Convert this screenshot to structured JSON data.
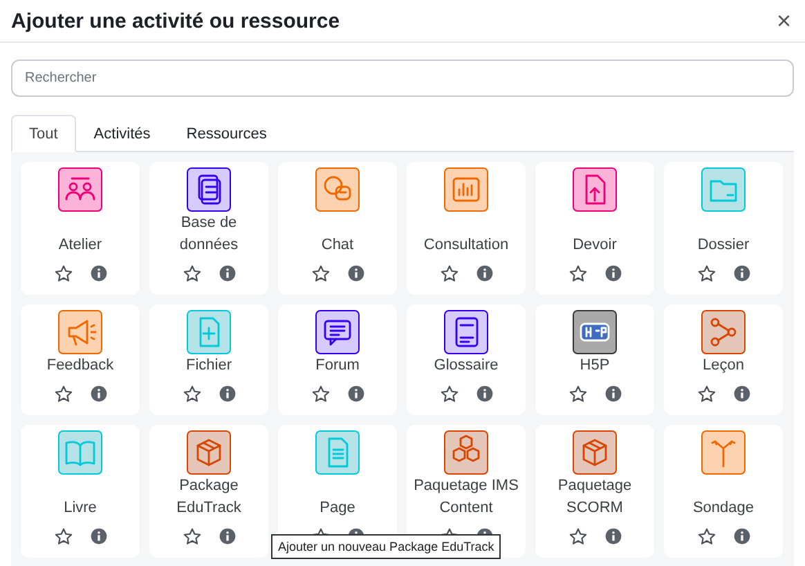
{
  "dialog": {
    "title": "Ajouter une activité ou ressource",
    "close": "×"
  },
  "search": {
    "placeholder": "Rechercher"
  },
  "tabs": [
    {
      "label": "Tout",
      "selected": true
    },
    {
      "label": "Activités",
      "selected": false
    },
    {
      "label": "Ressources",
      "selected": false
    }
  ],
  "items": [
    {
      "label": "Atelier",
      "kind": "people",
      "color": "#fbb4d8",
      "starred": false
    },
    {
      "label": "Base de données",
      "kind": "database",
      "color": "#d6cbfd",
      "starred": false
    },
    {
      "label": "Chat",
      "kind": "chat",
      "color": "#fcd2b1",
      "starred": false
    },
    {
      "label": "Consultation",
      "kind": "chart",
      "color": "#fcd2b1",
      "starred": false
    },
    {
      "label": "Devoir",
      "kind": "upload",
      "color": "#fbb4d8",
      "starred": false
    },
    {
      "label": "Dossier",
      "kind": "folder",
      "color": "#b5e2e6",
      "starred": false
    },
    {
      "label": "Feedback",
      "kind": "megaphone",
      "color": "#fcd2b1",
      "starred": false
    },
    {
      "label": "Fichier",
      "kind": "fileplus",
      "color": "#b5e2e6",
      "starred": false
    },
    {
      "label": "Forum",
      "kind": "forum",
      "color": "#d6cbfd",
      "starred": false
    },
    {
      "label": "Glossaire",
      "kind": "glossary",
      "color": "#d6cbfd",
      "starred": false
    },
    {
      "label": "H5P",
      "kind": "h5p",
      "color": "#a9a9a9",
      "starred": false
    },
    {
      "label": "Leçon",
      "kind": "lesson",
      "color": "#e3c6b8",
      "starred": false
    },
    {
      "label": "Livre",
      "kind": "book",
      "color": "#b5e2e6",
      "starred": false
    },
    {
      "label": "Package EduTrack",
      "kind": "package",
      "color": "#e3c6b8",
      "starred": false
    },
    {
      "label": "Page",
      "kind": "page",
      "color": "#b5e2e6",
      "starred": false
    },
    {
      "label": "Paquetage IMS Content",
      "kind": "packages",
      "color": "#e3c6b8",
      "starred": false
    },
    {
      "label": "Paquetage SCORM",
      "kind": "package",
      "color": "#e3c6b8",
      "starred": false
    },
    {
      "label": "Sondage",
      "kind": "signpost",
      "color": "#fcd2b1",
      "starred": false
    }
  ],
  "tooltip": "Ajouter un nouveau Package EduTrack"
}
